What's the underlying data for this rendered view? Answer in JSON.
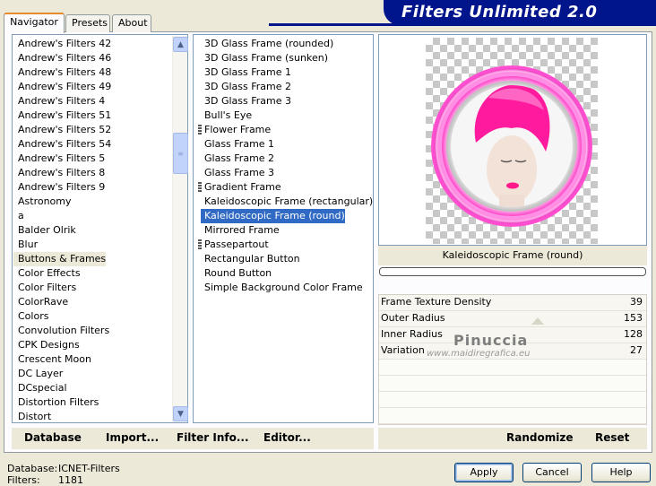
{
  "app": {
    "title": "Filters Unlimited 2.0"
  },
  "tabs": [
    {
      "label": "Navigator",
      "active": true
    },
    {
      "label": "Presets",
      "active": false
    },
    {
      "label": "About",
      "active": false
    }
  ],
  "categories": {
    "highlighted": "Buttons & Frames",
    "items": [
      "Andrew's Filters 42",
      "Andrew's Filters 46",
      "Andrew's Filters 48",
      "Andrew's Filters 49",
      "Andrew's Filters 4",
      "Andrew's Filters 51",
      "Andrew's Filters 52",
      "Andrew's Filters 54",
      "Andrew's Filters 5",
      "Andrew's Filters 8",
      "Andrew's Filters 9",
      "Astronomy",
      "a",
      "Balder Olrik",
      "Blur",
      "Buttons & Frames",
      "Color Effects",
      "Color Filters",
      "ColorRave",
      "Colors",
      "Convolution Filters",
      "CPK Designs",
      "Crescent Moon",
      "DC Layer",
      "DCspecial",
      "Distortion Filters",
      "Distort"
    ]
  },
  "filters": {
    "selected": "Kaleidoscopic Frame (round)",
    "items": [
      {
        "label": "3D Glass Frame (rounded)",
        "marker": false
      },
      {
        "label": "3D Glass Frame (sunken)",
        "marker": false
      },
      {
        "label": "3D Glass Frame 1",
        "marker": false
      },
      {
        "label": "3D Glass Frame 2",
        "marker": false
      },
      {
        "label": "3D Glass Frame 3",
        "marker": false
      },
      {
        "label": "Bull's Eye",
        "marker": false
      },
      {
        "label": "Flower Frame",
        "marker": true
      },
      {
        "label": "Glass Frame 1",
        "marker": false
      },
      {
        "label": "Glass Frame 2",
        "marker": false
      },
      {
        "label": "Glass Frame 3",
        "marker": false
      },
      {
        "label": "Gradient Frame",
        "marker": true
      },
      {
        "label": "Kaleidoscopic Frame (rectangular)",
        "marker": false
      },
      {
        "label": "Kaleidoscopic Frame (round)",
        "marker": false
      },
      {
        "label": "Mirrored Frame",
        "marker": false
      },
      {
        "label": "Passepartout",
        "marker": true
      },
      {
        "label": "Rectangular Button",
        "marker": false
      },
      {
        "label": "Round Button",
        "marker": false
      },
      {
        "label": "Simple Background Color Frame",
        "marker": false
      }
    ]
  },
  "preview": {
    "filter_name": "Kaleidoscopic Frame (round)",
    "ring_color": "#ff3cc8",
    "hair_color": "#ff1a9e"
  },
  "parameters": [
    {
      "label": "Frame Texture Density",
      "value": "39"
    },
    {
      "label": "Outer Radius",
      "value": "153"
    },
    {
      "label": "Inner Radius",
      "value": "128"
    },
    {
      "label": "Variation",
      "value": "27"
    }
  ],
  "watermark": {
    "name": "Pinuccia",
    "url": "www.maidiregrafica.eu"
  },
  "toolbar": {
    "database": "Database",
    "import": "Import...",
    "filter_info": "Filter Info...",
    "editor": "Editor...",
    "randomize": "Randomize",
    "reset": "Reset"
  },
  "status": {
    "database_label": "Database:",
    "database_value": "ICNET-Filters",
    "filters_label": "Filters:",
    "filters_value": "1181"
  },
  "buttons": {
    "apply": "Apply",
    "cancel": "Cancel",
    "help": "Help"
  },
  "colors": {
    "banner": "#00148c",
    "selection": "#316ac5",
    "window": "#ece9d8"
  }
}
